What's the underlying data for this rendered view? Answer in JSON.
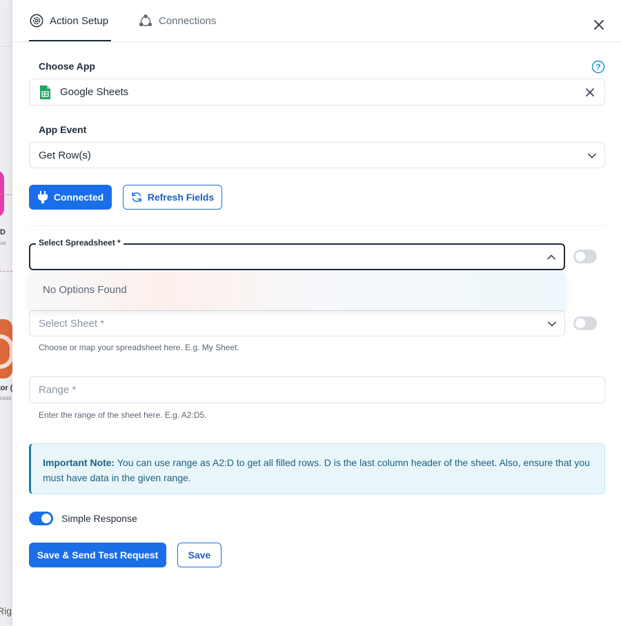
{
  "background": {
    "node_title_1": "D",
    "node_sub_1": "ue",
    "node_title_2": "tor (",
    "node_sub_2": "cess",
    "bottom_text": "Rig"
  },
  "tabs": [
    {
      "label": "Action Setup",
      "icon": "gear-icon",
      "active": true
    },
    {
      "label": "Connections",
      "icon": "connections-icon",
      "active": false
    }
  ],
  "choose_app": {
    "label": "Choose App",
    "value": "Google Sheets",
    "icon": "google-sheets-icon"
  },
  "app_event": {
    "label": "App Event",
    "value": "Get Row(s)"
  },
  "buttons": {
    "connected": "Connected",
    "refresh_fields": "Refresh Fields",
    "save_send": "Save & Send Test Request",
    "save": "Save"
  },
  "select_spreadsheet": {
    "label": "Select Spreadsheet *",
    "dropdown_message": "No Options Found"
  },
  "select_sheet": {
    "placeholder": "Select Sheet *",
    "help": "Choose or map your spreadsheet here. E.g. My Sheet."
  },
  "range": {
    "placeholder": "Range *",
    "help": "Enter the range of the sheet here. E.g. A2:D5."
  },
  "note": {
    "title": "Important Note:",
    "text": " You can use range as A2:D to get all filled rows. D is the last column header of the sheet. Also, ensure that you must have data in the given range."
  },
  "simple_response": {
    "label": "Simple Response",
    "enabled": true
  },
  "colors": {
    "primary": "#1a6fe8",
    "note_bg": "#e8f6fa",
    "note_accent": "#1b7f9f"
  }
}
